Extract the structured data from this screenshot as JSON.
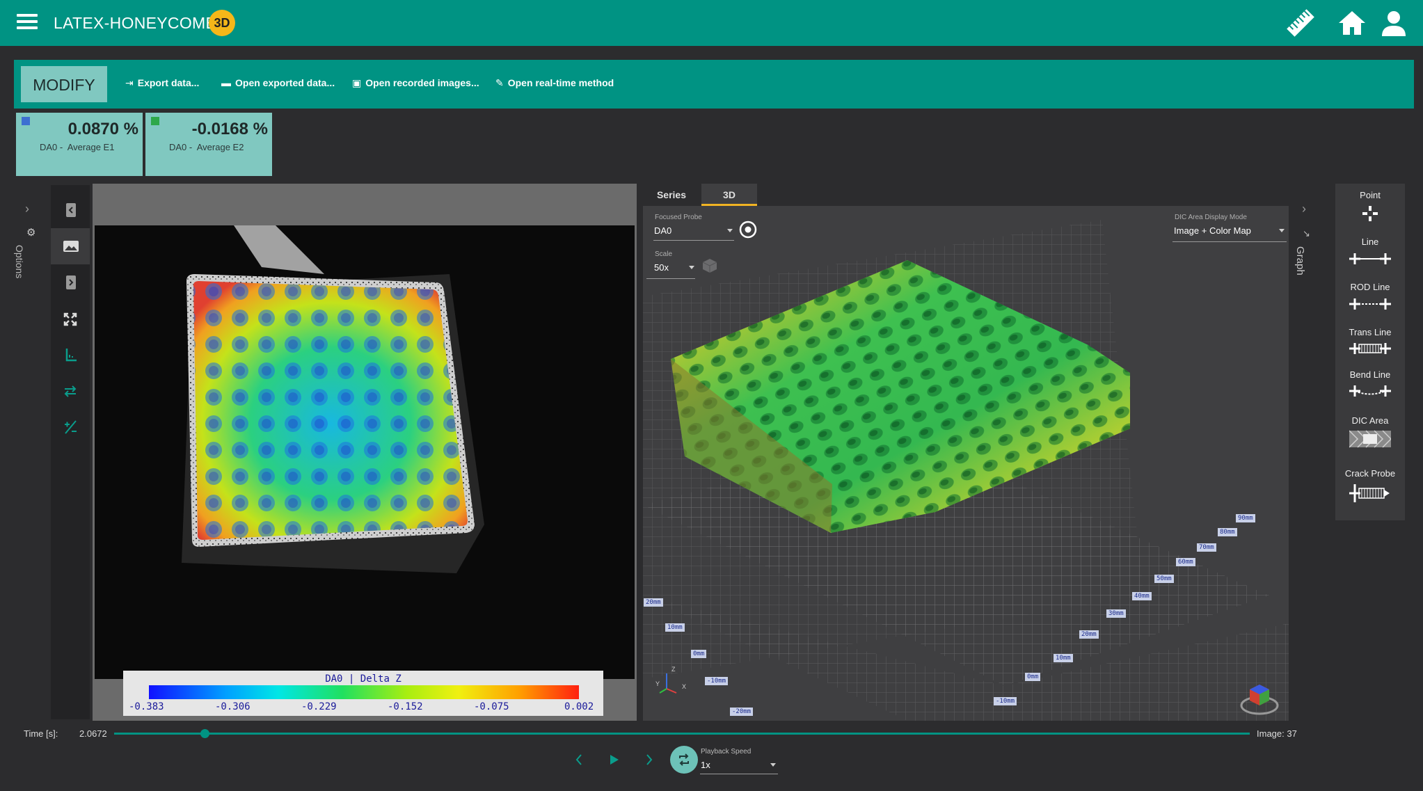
{
  "header": {
    "title": "LATEX-HONEYCOMB",
    "mode_badge": "3D",
    "icons": [
      "menu-icon",
      "ruler-icon",
      "home-icon",
      "user-icon"
    ]
  },
  "toolbar": {
    "modify_label": "MODIFY",
    "actions": [
      {
        "label": "Export data...",
        "icon": "export-icon"
      },
      {
        "label": "Open exported data...",
        "icon": "folder-icon"
      },
      {
        "label": "Open recorded images...",
        "icon": "images-icon"
      },
      {
        "label": "Open real-time method",
        "icon": "pencil-icon"
      }
    ]
  },
  "stats": [
    {
      "value": "0.0870 %",
      "probe": "DA0 -",
      "label": "Average E1",
      "color": "#3d6fd1"
    },
    {
      "value": "-0.0168 %",
      "probe": "DA0 -",
      "label": "Average E2",
      "color": "#2ea84a"
    }
  ],
  "left_panel": {
    "options_label": "Options",
    "tools": [
      "collapse-left-icon",
      "image-icon",
      "collapse-right-icon",
      "fit-screen-icon",
      "axes-icon",
      "swap-icon",
      "scale-icon"
    ]
  },
  "colorbar": {
    "title": "DA0 |  Delta Z",
    "ticks": [
      "-0.383",
      "-0.306",
      "-0.229",
      "-0.152",
      "-0.075",
      "0.002"
    ]
  },
  "view3d": {
    "tabs": [
      "Series",
      "3D"
    ],
    "active_tab": "3D",
    "focused_probe_label": "Focused Probe",
    "focused_probe_value": "DA0",
    "scale_label": "Scale",
    "scale_value": "50x",
    "display_mode_label": "DIC Area Display Mode",
    "display_mode_value": "Image + Color Map",
    "axis_x_ticks": [
      "10mm",
      "20mm",
      "30mm",
      "40mm",
      "50mm",
      "60mm",
      "70mm",
      "80mm",
      "90mm"
    ],
    "axis_y_ticks": [
      "20mm",
      "10mm",
      "0mm",
      "-10mm",
      "-20mm"
    ],
    "axis_y2_ticks": [
      "0mm",
      "-10mm"
    ],
    "triad": {
      "z": "Z",
      "y": "Y",
      "x": "X"
    }
  },
  "graph_label": "Graph",
  "probes": [
    "Point",
    "Line",
    "ROD Line",
    "Trans Line",
    "Bend Line",
    "DIC Area",
    "Crack Probe"
  ],
  "playback": {
    "time_label": "Time [s]:",
    "time_value": "2.0672",
    "progress": 0.08,
    "image_label": "Image: 37",
    "speed_label": "Playback Speed",
    "speed_value": "1x"
  }
}
